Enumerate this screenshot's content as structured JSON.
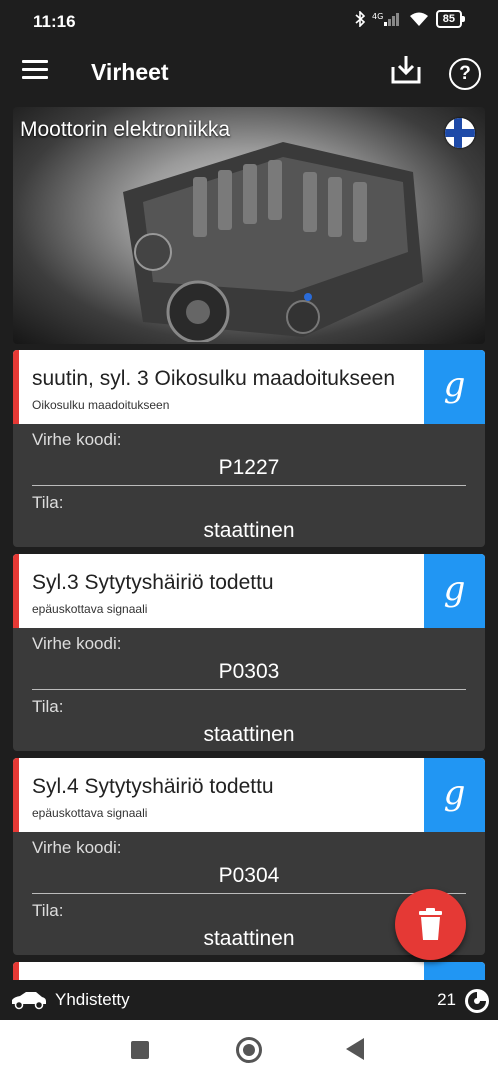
{
  "status": {
    "time": "11:16",
    "battery": "85"
  },
  "appbar": {
    "title": "Virheet"
  },
  "hero": {
    "title": "Moottorin elektroniikka"
  },
  "errors": [
    {
      "title": "suutin, syl. 3 Oikosulku maadoitukseen",
      "subtitle": "Oikosulku maadoitukseen",
      "code_label": "Virhe koodi:",
      "code": "P1227",
      "state_label": "Tila:",
      "state": "staattinen",
      "search_glyph": "g"
    },
    {
      "title": "Syl.3 Sytytyshäiriö todettu",
      "subtitle": "epäuskottava signaali",
      "code_label": "Virhe koodi:",
      "code": "P0303",
      "state_label": "Tila:",
      "state": "staattinen",
      "search_glyph": "g"
    },
    {
      "title": "Syl.4 Sytytyshäiriö todettu",
      "subtitle": "epäuskottava signaali",
      "code_label": "Virhe koodi:",
      "code": "P0304",
      "state_label": "Tila:",
      "state": "staattinen",
      "search_glyph": "g"
    }
  ],
  "bottom": {
    "connection": "Yhdistetty",
    "count": "21"
  },
  "colors": {
    "accent_red": "#e53935",
    "google_blue": "#2196f3",
    "background": "#1e1e1e",
    "card": "#3a3a3a"
  },
  "icons": [
    "menu-icon",
    "download-icon",
    "help-icon",
    "finland-flag-icon",
    "google-search-icon",
    "trash-icon",
    "car-icon",
    "sync-icon"
  ]
}
